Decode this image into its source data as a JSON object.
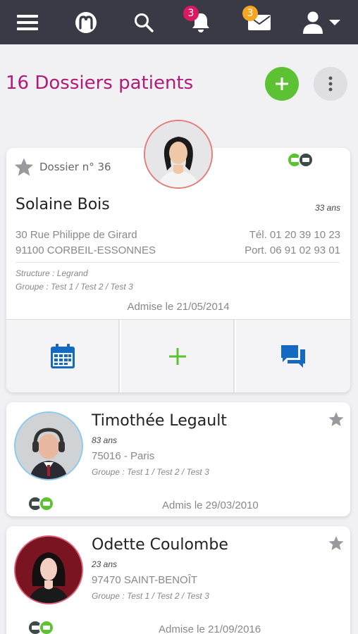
{
  "topbar": {
    "notif_count": "3",
    "mail_count": "3",
    "bg": "#3a3a47",
    "notif_badge_color": "#d81b60",
    "mail_badge_color": "#f5a623"
  },
  "page": {
    "title": "16 Dossiers patients",
    "accent": "#b01a78",
    "add_color": "#5cc133"
  },
  "featured": {
    "dossier_label": "Dossier n° 36",
    "name": "Solaine Bois",
    "age": "33 ans",
    "address1": "30 Rue Philippe de Girard",
    "address2": "91100 CORBEIL-ESSONNES",
    "tel": "Tél. 01 20 39 10 23",
    "port": "Port. 06 91 02 93 01",
    "structure": "Structure : Legrand",
    "groupe": "Groupe : Test 1 / Test 2 / Test 3",
    "admission": "Admise le 21/05/2014"
  },
  "patients": [
    {
      "name": "Timothée Legault",
      "age": "83 ans",
      "city": "75016 - Paris",
      "groupe": "Groupe : Test 1 / Test 2 / Test 3",
      "admission": "Admis le 29/03/2010"
    },
    {
      "name": "Odette Coulombe",
      "age": "23 ans",
      "city": "97470 SAINT-BENOÎT",
      "groupe": "Groupe : Test 1 / Test 2 / Test 3",
      "admission": "Admise le 21/09/2016"
    }
  ],
  "icons": {
    "menu": "hamburger-menu-icon",
    "logo": "app-logo-icon",
    "search": "search-icon",
    "bell": "bell-icon",
    "mail": "mail-icon",
    "user": "user-icon",
    "star": "star-icon",
    "calendar": "calendar-icon",
    "plus": "plus-icon",
    "chat": "chat-icon"
  }
}
